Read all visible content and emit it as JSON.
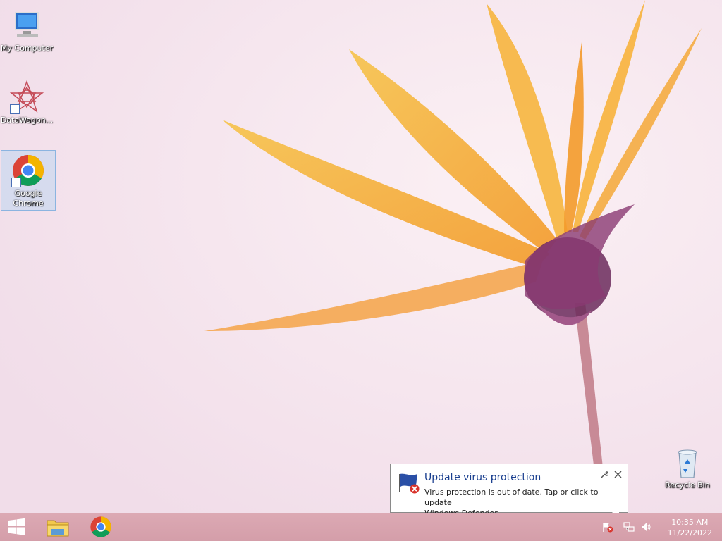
{
  "desktop": {
    "icons": [
      {
        "label": "My Computer"
      },
      {
        "label": "DataWagon..."
      },
      {
        "label_line1": "Google",
        "label_line2": "Chrome"
      },
      {
        "label": "Recycle Bin"
      }
    ]
  },
  "notification": {
    "title": "Update virus protection",
    "message_line1": "Virus protection is out of date. Tap or click to update",
    "message_line2": "Windows Defender."
  },
  "taskbar": {
    "clock_time": "10:35 AM",
    "clock_date": "11/22/2022"
  },
  "colors": {
    "balloon_title": "#1a3f8f",
    "taskbar": "#d49ea9"
  }
}
